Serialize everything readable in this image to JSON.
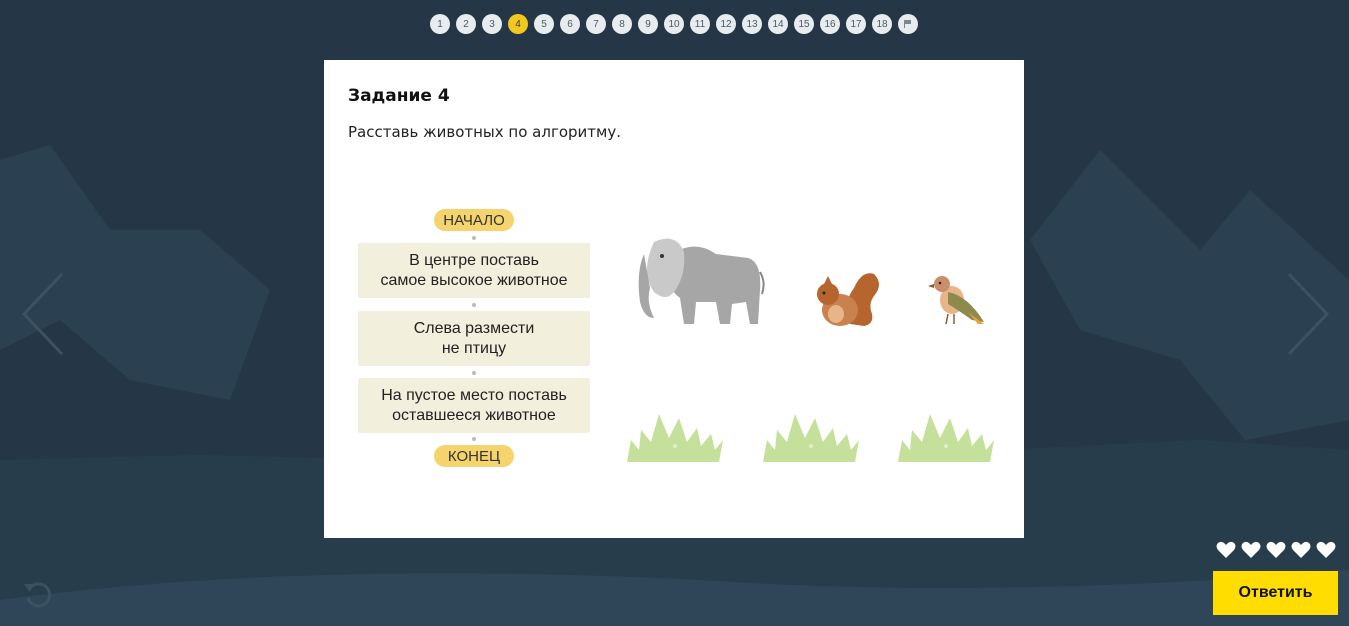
{
  "pager": {
    "pages": [
      "1",
      "2",
      "3",
      "4",
      "5",
      "6",
      "7",
      "8",
      "9",
      "10",
      "11",
      "12",
      "13",
      "14",
      "15",
      "16",
      "17",
      "18"
    ],
    "active": "4",
    "flag_icon": "flag-icon"
  },
  "task": {
    "title": "Задание 4",
    "instruction": "Расставь животных по алгоритму."
  },
  "algorithm": {
    "start": "НАЧАЛО",
    "steps": [
      {
        "line1": "В центре поставь",
        "line2": "самое высокое животное"
      },
      {
        "line1": "Слева размести",
        "line2": "не птицу"
      },
      {
        "line1": "На пустое место поставь",
        "line2": "оставшееся животное"
      }
    ],
    "end": "КОНЕЦ"
  },
  "animals": [
    "elephant-icon",
    "squirrel-icon",
    "bird-icon"
  ],
  "slots": [
    "grass-slot-left",
    "grass-slot-center",
    "grass-slot-right"
  ],
  "lives": {
    "count": 5,
    "icon": "heart-icon"
  },
  "buttons": {
    "submit": "Ответить"
  },
  "colors": {
    "background": "#253746",
    "accent": "#ffdd00",
    "pill": "#f5d46e",
    "step": "#f3efdd",
    "grass": "#c5e09a"
  }
}
